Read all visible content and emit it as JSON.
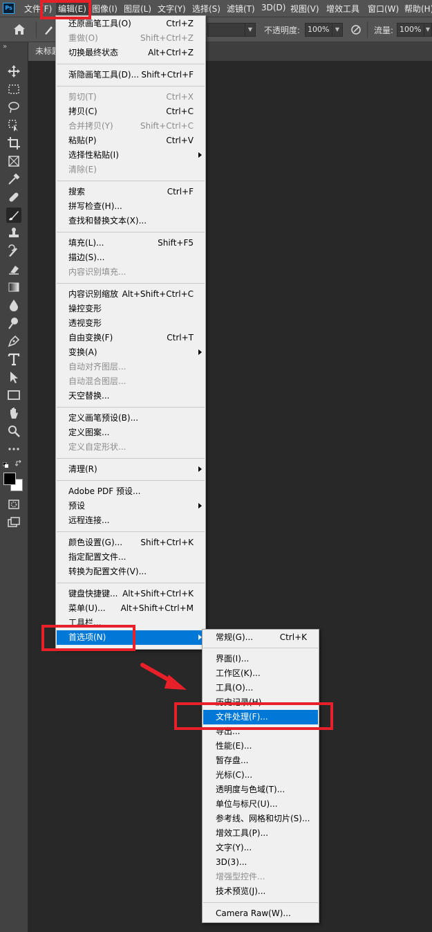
{
  "menubar": {
    "logo": "Ps",
    "items": [
      "文件(F)",
      "编辑(E)",
      "图像(I)",
      "图层(L)",
      "文字(Y)",
      "选择(S)",
      "滤镜(T)",
      "3D(D)",
      "视图(V)",
      "增效工具",
      "窗口(W)",
      "帮助(H)"
    ]
  },
  "options": {
    "opacity_label": "不透明度:",
    "opacity_value": "100%",
    "flow_label": "流量:",
    "flow_value": "100%"
  },
  "toolbar": {
    "collapse": "»"
  },
  "doc": {
    "tab_label": "未标题"
  },
  "edit_menu": {
    "items": [
      {
        "label": "还原画笔工具(O)",
        "shortcut": "Ctrl+Z"
      },
      {
        "label": "重做(O)",
        "shortcut": "Shift+Ctrl+Z",
        "disabled": true
      },
      {
        "label": "切换最终状态",
        "shortcut": "Alt+Ctrl+Z"
      },
      {
        "label": "渐隐画笔工具(D)...",
        "shortcut": "Shift+Ctrl+F"
      },
      {
        "label": "剪切(T)",
        "shortcut": "Ctrl+X",
        "disabled": true
      },
      {
        "label": "拷贝(C)",
        "shortcut": "Ctrl+C"
      },
      {
        "label": "合并拷贝(Y)",
        "shortcut": "Shift+Ctrl+C",
        "disabled": true
      },
      {
        "label": "粘贴(P)",
        "shortcut": "Ctrl+V"
      },
      {
        "label": "选择性粘贴(I)",
        "shortcut": "",
        "submenu": true
      },
      {
        "label": "清除(E)",
        "shortcut": "",
        "disabled": true
      },
      {
        "label": "搜索",
        "shortcut": "Ctrl+F"
      },
      {
        "label": "拼写检查(H)...",
        "shortcut": ""
      },
      {
        "label": "查找和替换文本(X)...",
        "shortcut": ""
      },
      {
        "label": "填充(L)...",
        "shortcut": "Shift+F5"
      },
      {
        "label": "描边(S)...",
        "shortcut": ""
      },
      {
        "label": "内容识别填充...",
        "shortcut": "",
        "disabled": true
      },
      {
        "label": "内容识别缩放",
        "shortcut": "Alt+Shift+Ctrl+C"
      },
      {
        "label": "操控变形",
        "shortcut": ""
      },
      {
        "label": "透视变形",
        "shortcut": ""
      },
      {
        "label": "自由变换(F)",
        "shortcut": "Ctrl+T"
      },
      {
        "label": "变换(A)",
        "shortcut": "",
        "submenu": true
      },
      {
        "label": "自动对齐图层...",
        "shortcut": "",
        "disabled": true
      },
      {
        "label": "自动混合图层...",
        "shortcut": "",
        "disabled": true
      },
      {
        "label": "天空替换...",
        "shortcut": ""
      },
      {
        "label": "定义画笔预设(B)...",
        "shortcut": ""
      },
      {
        "label": "定义图案...",
        "shortcut": ""
      },
      {
        "label": "定义自定形状...",
        "shortcut": "",
        "disabled": true
      },
      {
        "label": "清理(R)",
        "shortcut": "",
        "submenu": true
      },
      {
        "label": "Adobe PDF 预设...",
        "shortcut": ""
      },
      {
        "label": "预设",
        "shortcut": "",
        "submenu": true
      },
      {
        "label": "远程连接...",
        "shortcut": ""
      },
      {
        "label": "颜色设置(G)...",
        "shortcut": "Shift+Ctrl+K"
      },
      {
        "label": "指定配置文件...",
        "shortcut": ""
      },
      {
        "label": "转换为配置文件(V)...",
        "shortcut": ""
      },
      {
        "label": "键盘快捷键...",
        "shortcut": "Alt+Shift+Ctrl+K"
      },
      {
        "label": "菜单(U)...",
        "shortcut": "Alt+Shift+Ctrl+M"
      },
      {
        "label": "工具栏...",
        "shortcut": ""
      },
      {
        "label": "首选项(N)",
        "shortcut": "",
        "submenu": true,
        "highlighted": true
      }
    ]
  },
  "preferences_submenu": {
    "items": [
      {
        "label": "常规(G)...",
        "shortcut": "Ctrl+K"
      },
      {
        "label": "界面(I)...",
        "shortcut": ""
      },
      {
        "label": "工作区(K)...",
        "shortcut": ""
      },
      {
        "label": "工具(O)...",
        "shortcut": ""
      },
      {
        "label": "历史记录(H)...",
        "shortcut": ""
      },
      {
        "label": "文件处理(F)...",
        "shortcut": "",
        "highlighted": true
      },
      {
        "label": "导出...",
        "shortcut": ""
      },
      {
        "label": "性能(E)...",
        "shortcut": ""
      },
      {
        "label": "暂存盘...",
        "shortcut": ""
      },
      {
        "label": "光标(C)...",
        "shortcut": ""
      },
      {
        "label": "透明度与色域(T)...",
        "shortcut": ""
      },
      {
        "label": "单位与标尺(U)...",
        "shortcut": ""
      },
      {
        "label": "参考线、网格和切片(S)...",
        "shortcut": ""
      },
      {
        "label": "增效工具(P)...",
        "shortcut": ""
      },
      {
        "label": "文字(Y)...",
        "shortcut": ""
      },
      {
        "label": "3D(3)...",
        "shortcut": ""
      },
      {
        "label": "增强型控件...",
        "shortcut": "",
        "disabled": true
      },
      {
        "label": "技术预览(J)...",
        "shortcut": ""
      },
      {
        "label": "Camera Raw(W)...",
        "shortcut": ""
      }
    ]
  },
  "colors": {
    "highlight": "#0078d7",
    "annotation": "#e8202a"
  }
}
